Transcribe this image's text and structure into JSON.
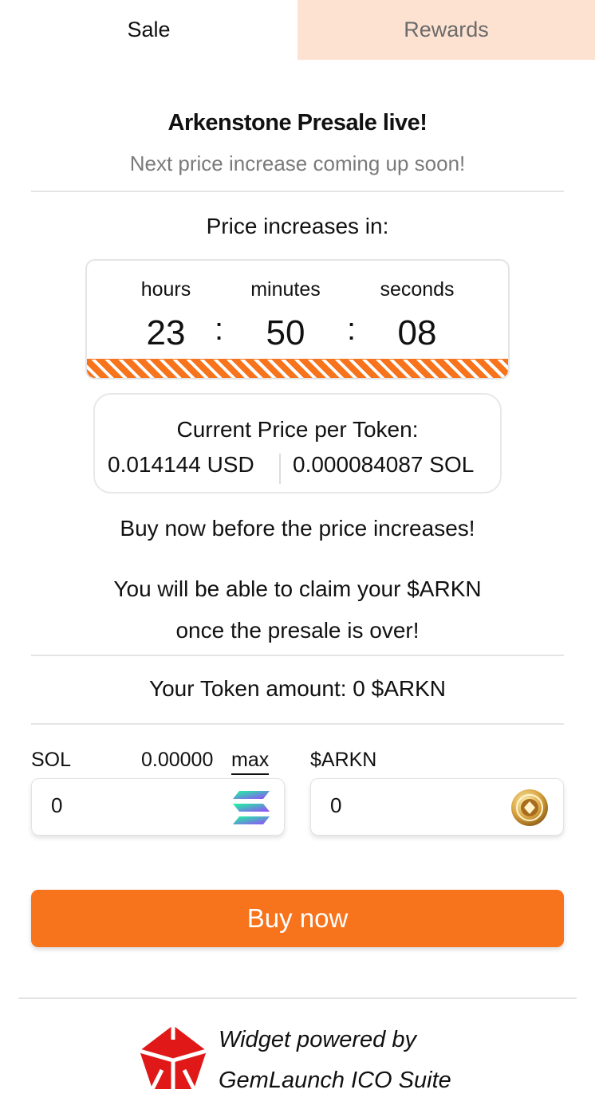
{
  "tabs": [
    {
      "label": "Sale",
      "active": true
    },
    {
      "label": "Rewards",
      "active": false
    }
  ],
  "header": {
    "title": "Arkenstone Presale live!",
    "subtitle": "Next price increase coming up soon!"
  },
  "countdown": {
    "heading": "Price increases in:",
    "hours_label": "hours",
    "minutes_label": "minutes",
    "seconds_label": "seconds",
    "hours": "23",
    "minutes": "50",
    "seconds": "08",
    "separator": ":"
  },
  "price": {
    "label": "Current Price per Token:",
    "usd": "0.014144 USD",
    "sol": "0.000084087 SOL"
  },
  "messages": {
    "buy_now": "Buy now before the price increases!",
    "claim_line1": "You will be able to claim your $ARKN",
    "claim_line2": "once the presale is over!"
  },
  "token_amount": "Your Token amount: 0 $ARKN",
  "form": {
    "sol_label": "SOL",
    "sol_balance": "0.00000",
    "max_label": "max",
    "sol_value": "0",
    "arkn_label": "$ARKN",
    "arkn_value": "0"
  },
  "buy_button": "Buy now",
  "footer": {
    "line1": "Widget powered by",
    "line2": "GemLaunch ICO Suite"
  },
  "icons": {
    "sol": "solana-icon",
    "arkn": "arkenstone-token-icon",
    "logo": "gemlaunch-logo"
  },
  "colors": {
    "accent": "#f7731c",
    "inactive_tab": "#fde2d1"
  }
}
